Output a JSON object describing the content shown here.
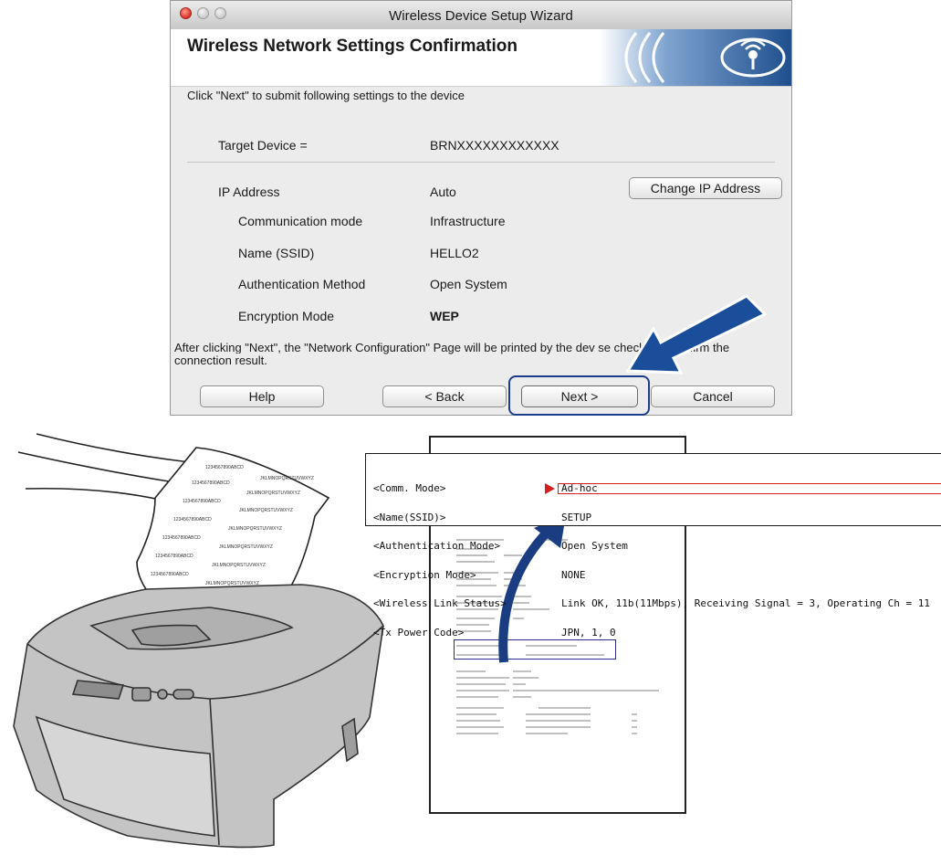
{
  "window": {
    "title": "Wireless Device Setup Wizard",
    "header_title": "Wireless Network Settings Confirmation",
    "intro": "Click \"Next\" to submit following settings to the device",
    "target_label": "Target Device =",
    "target_value": "BRNXXXXXXXXXXXX",
    "ip_label": "IP Address",
    "ip_value": "Auto",
    "change_ip_button": "Change IP Address",
    "settings": [
      {
        "label": "Communication mode",
        "value": "Infrastructure"
      },
      {
        "label": "Name (SSID)",
        "value": "HELLO2"
      },
      {
        "label": "Authentication Method",
        "value": "Open System"
      },
      {
        "label": "Encryption Mode",
        "value": "WEP"
      }
    ],
    "after_text": "After clicking \"Next\", the \"Network Configuration\" Page will be printed by the dev          se check it to confirm the connection result.",
    "buttons": {
      "help": "Help",
      "back": "< Back",
      "next": "Next >",
      "cancel": "Cancel"
    },
    "accent_color": "#1c3e8a"
  },
  "report_zoom": {
    "labels": [
      "<Comm. Mode>",
      "<Name(SSID)>",
      "<Authentication Mode>",
      "<Encryption Mode>",
      "<Wireless Link Status>",
      "<Tx Power Code>"
    ],
    "values": [
      "Ad-hoc",
      "SETUP",
      "Open System",
      "NONE",
      "Link OK, 11b(11Mbps), Receiving Signal = 3, Operating Ch = 11",
      "JPN, 1, 0"
    ],
    "highlight_color": "#d41f1f"
  },
  "printed_sheet": {
    "lines": [
      "1234567890ABCD",
      "JKLMNOPQRSTUVWXYZ"
    ]
  }
}
